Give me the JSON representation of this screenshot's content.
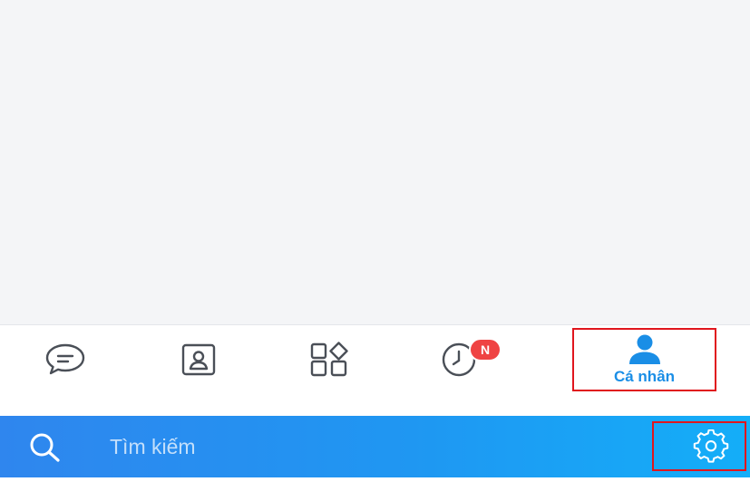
{
  "bottom_nav": {
    "items": [
      {
        "id": "messages",
        "icon": "chat-bubble-icon",
        "label": ""
      },
      {
        "id": "contacts",
        "icon": "contact-card-icon",
        "label": ""
      },
      {
        "id": "discover",
        "icon": "apps-grid-icon",
        "label": ""
      },
      {
        "id": "timeline",
        "icon": "clock-icon",
        "label": "",
        "badge": "N"
      },
      {
        "id": "profile",
        "icon": "person-icon",
        "label": "Cá nhân",
        "active": true
      }
    ]
  },
  "search": {
    "placeholder": "Tìm kiếm",
    "settings_icon": "gear-icon"
  },
  "colors": {
    "accent": "#1a8ee6",
    "badge": "#ef4343",
    "search_bar_start": "#2f86ee",
    "search_bar_end": "#14aef8",
    "highlight": "#e0161d",
    "icon_inactive": "#4a4f57"
  }
}
